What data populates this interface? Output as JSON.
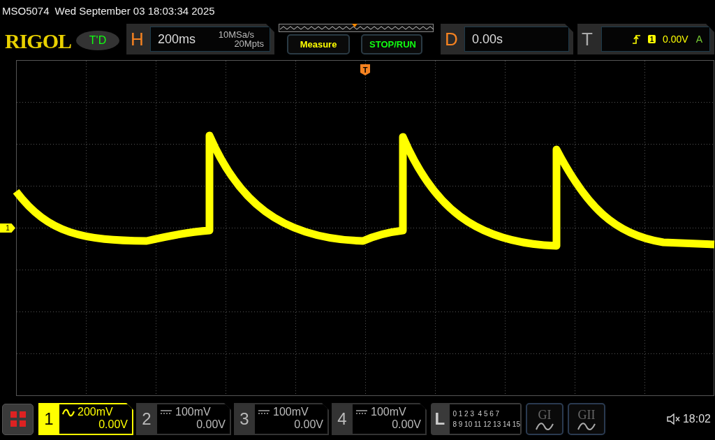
{
  "title_bar": {
    "model": "MSO5074",
    "datetime": "Wed September 03 18:03:34 2025"
  },
  "header": {
    "logo": "RIGOL",
    "mode_badge": "T'D",
    "horizontal": {
      "label": "H",
      "timebase": "200ms",
      "sample_rate": "10MSa/s",
      "memory_depth": "20Mpts"
    },
    "buttons": [
      {
        "label": "Measure",
        "kind": "measure"
      },
      {
        "label": "STOP/RUN",
        "kind": "run"
      }
    ],
    "delay": {
      "label": "D",
      "value": "0.00s"
    },
    "trigger": {
      "label": "T",
      "source": "1",
      "level": "0.00V",
      "mode": "A"
    }
  },
  "screen": {
    "trigger_marker": "T",
    "channel_marker": "1"
  },
  "channels": [
    {
      "number": "1",
      "ac_coupled": true,
      "scale": "200mV",
      "offset": "0.00V",
      "selected": true
    },
    {
      "number": "2",
      "ac_coupled": false,
      "scale": "100mV",
      "offset": "0.00V",
      "selected": false
    },
    {
      "number": "3",
      "ac_coupled": false,
      "scale": "100mV",
      "offset": "0.00V",
      "selected": false
    },
    {
      "number": "4",
      "ac_coupled": false,
      "scale": "100mV",
      "offset": "0.00V",
      "selected": false
    }
  ],
  "logic": {
    "label": "L",
    "rows": [
      "0 1 2 3  4 5 6 7",
      "8 9 10 11 12 13 14 15"
    ]
  },
  "generators": [
    {
      "label": "GI"
    },
    {
      "label": "GII"
    }
  ],
  "status": {
    "time": "18:02"
  }
}
